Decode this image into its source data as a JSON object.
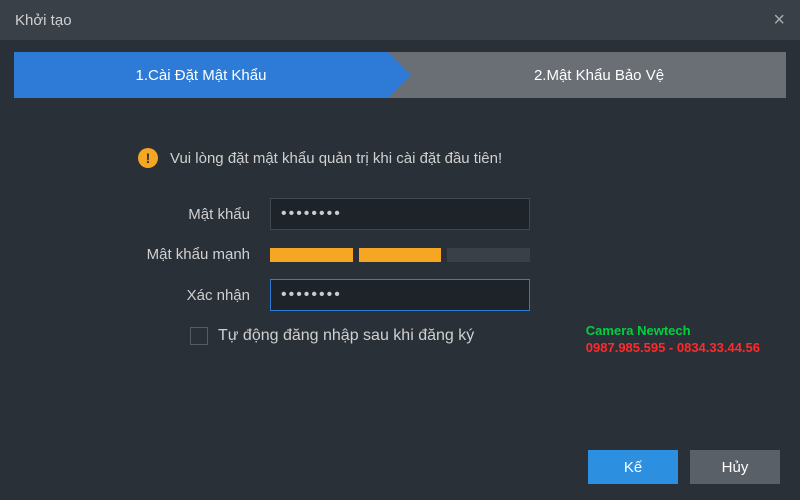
{
  "window": {
    "title": "Khởi tạo",
    "close": "×"
  },
  "steps": {
    "s1": "1.Cài Đặt Mật Khẩu",
    "s2": "2.Mật Khẩu Bảo Vệ"
  },
  "notice": {
    "icon": "!",
    "text": "Vui lòng đặt mật khẩu quản trị khi cài đặt đầu tiên!"
  },
  "form": {
    "password_label": "Mật khẩu",
    "password_value": "••••••••",
    "strength_label": "Mật khẩu mạnh",
    "strength_segments": [
      true,
      true,
      false
    ],
    "confirm_label": "Xác nhận",
    "confirm_value": "••••••••",
    "autologin_label": "Tự động đăng nhập sau khi đăng ký",
    "autologin_checked": false
  },
  "watermark": {
    "line1": "Camera Newtech",
    "line2": "0987.985.595 - 0834.33.44.56"
  },
  "buttons": {
    "next": "Kế",
    "cancel": "Hủy"
  }
}
